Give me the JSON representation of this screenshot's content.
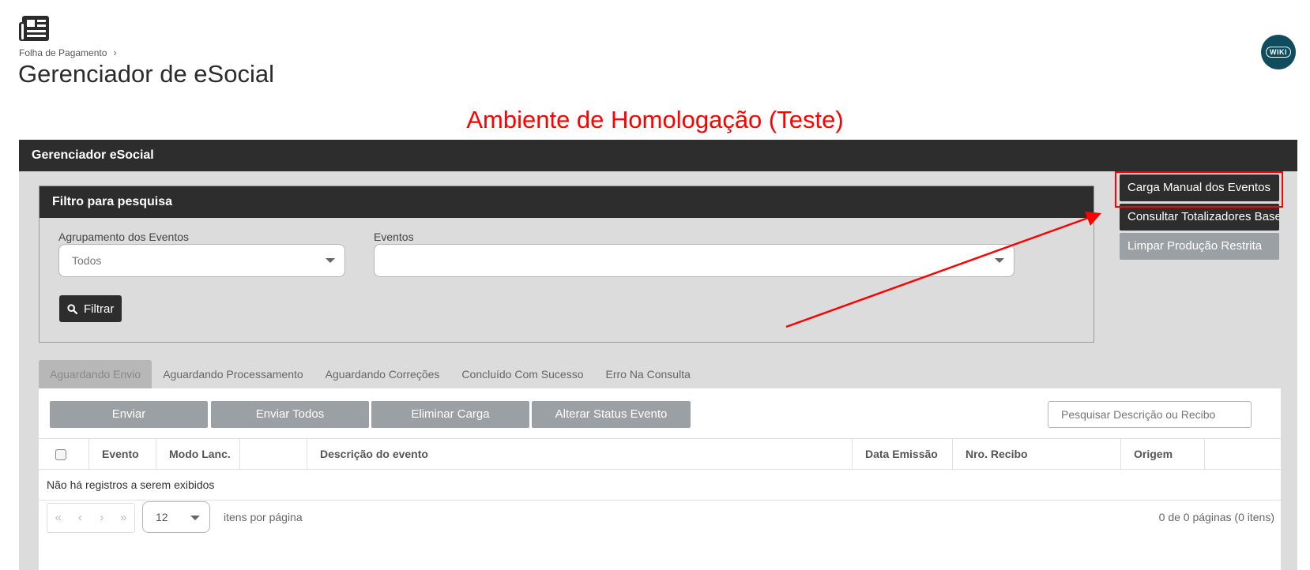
{
  "header": {
    "app_icon": "newspaper-icon",
    "breadcrumb": "Folha de Pagamento",
    "breadcrumb_separator": "›",
    "title": "Gerenciador de eSocial",
    "wiki_label": "WIKI"
  },
  "environment_banner": "Ambiente de Homologação (Teste)",
  "panel": {
    "title": "Gerenciador eSocial",
    "filter": {
      "title": "Filtro para pesquisa",
      "grouping_label": "Agrupamento dos Eventos",
      "grouping_value": "Todos",
      "events_label": "Eventos",
      "events_value": "",
      "filter_button": "Filtrar",
      "filter_icon": "search-icon"
    },
    "side_buttons": {
      "manual_load": "Carga Manual dos Eventos",
      "totals": "Consultar Totalizadores Base",
      "clear_restricted": "Limpar Produção Restrita"
    },
    "tabs": [
      "Aguardando Envio",
      "Aguardando Processamento",
      "Aguardando Correções",
      "Concluído Com Sucesso",
      "Erro Na Consulta"
    ],
    "actions": {
      "send": "Enviar",
      "send_all": "Enviar Todos",
      "delete_load": "Eliminar Carga",
      "change_status": "Alterar Status Evento",
      "search_placeholder": "Pesquisar Descrição ou Recibo"
    },
    "grid": {
      "columns": [
        "",
        "Evento",
        "Modo Lanc.",
        "",
        "Descrição do evento",
        "Data Emissão",
        "Nro. Recibo",
        "Origem"
      ],
      "empty_message": "Não há registros a serem exibidos"
    },
    "pager": {
      "first": "«",
      "prev": "‹",
      "next": "›",
      "last": "»",
      "page_size": "12",
      "page_size_label": "itens por página",
      "info": "0 de 0 páginas (0 itens)"
    }
  },
  "colors": {
    "dark_header": "#2d2d2d",
    "panel_bg": "#dcdcdc",
    "button_grey": "#9ba0a5",
    "banner_red": "#ff0000",
    "wiki_teal": "#0e4c5e"
  }
}
